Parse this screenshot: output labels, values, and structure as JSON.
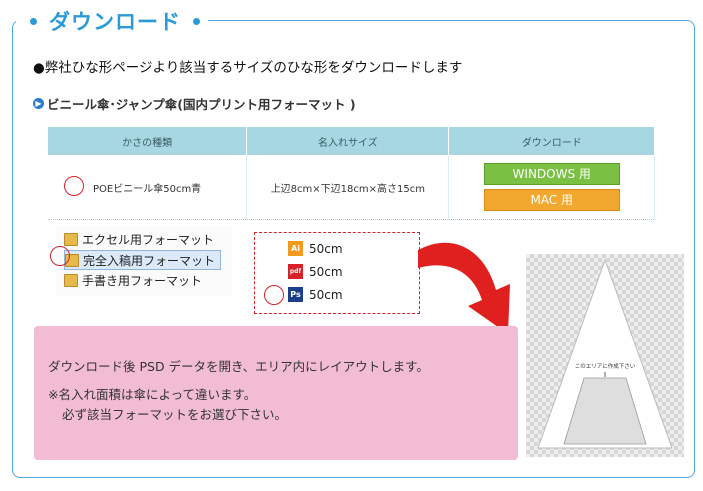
{
  "header": {
    "title": "ダウンロード"
  },
  "lead_text": "●弊社ひな形ページより該当するサイズのひな形をダウンロードします",
  "subheading": "ビニール傘･ジャンプ傘(国内プリント用フォーマット )",
  "table": {
    "headers": [
      "かさの種類",
      "名入れサイズ",
      "ダウンロード"
    ],
    "row": {
      "type": "POEビニール傘50cm青",
      "size": "上辺8cm×下辺18cm×高さ15cm"
    },
    "windows_button": "WINDOWS 用",
    "mac_button": "MAC 用"
  },
  "folders": [
    "エクセル用フォーマット",
    "完全入稿用フォーマット",
    "手書き用フォーマット"
  ],
  "files": [
    {
      "icon": "Ai",
      "name": "50cm",
      "color": "#f39a1e"
    },
    {
      "icon": "pdf",
      "name": "50cm",
      "color": "#d8222a"
    },
    {
      "icon": "Ps",
      "name": "50cm",
      "color": "#1d3f8a"
    }
  ],
  "instructions": {
    "line1": "ダウンロード後 PSD データを開き、エリア内にレイアウトします。",
    "line2": "※名入れ面積は傘によって違います。",
    "line3": "必ず該当フォーマットをお選び下さい。"
  },
  "template_label": "このエリアに作成下さい",
  "colors": {
    "accent": "#2a9bd6",
    "table_header": "#a7d8e2",
    "pink_box": "#f2bdd4",
    "highlight_red": "#d8222a"
  }
}
